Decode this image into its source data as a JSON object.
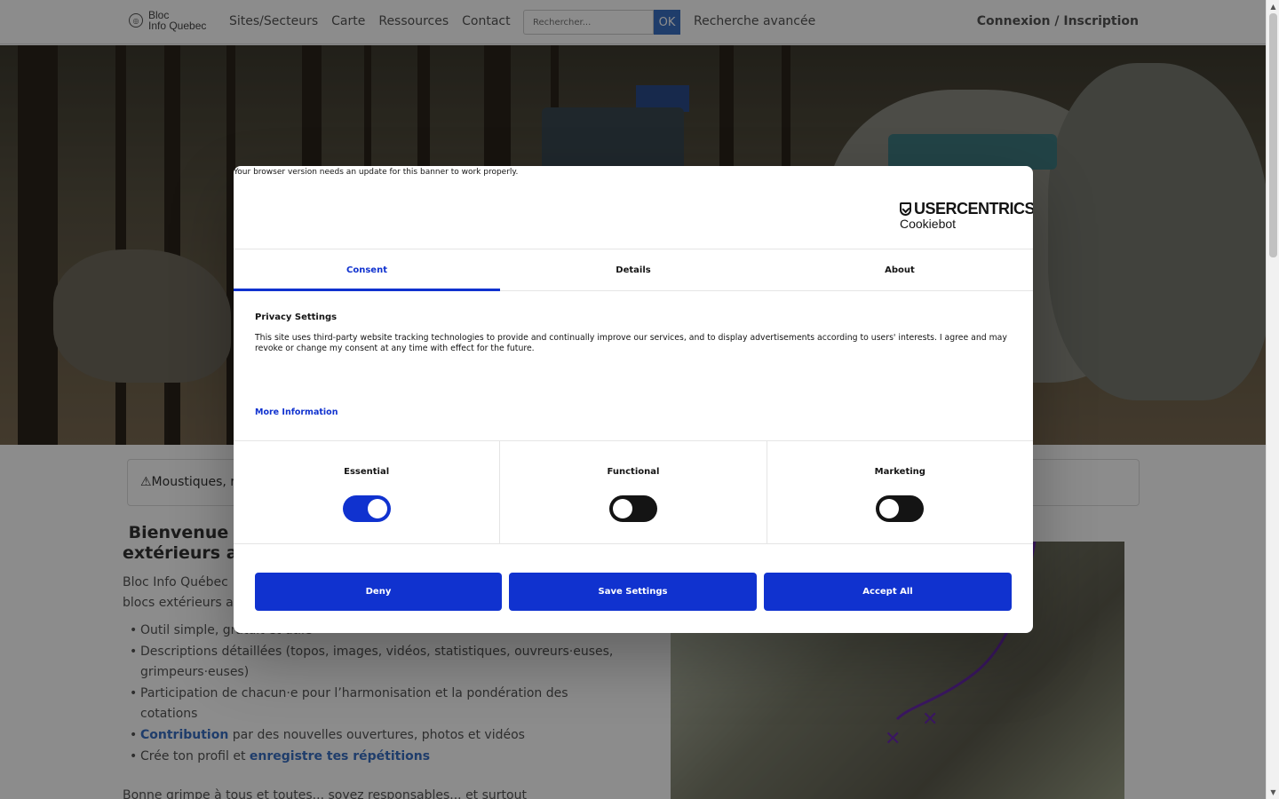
{
  "navbar": {
    "logo_line1": "Bloc",
    "logo_line2": "Info Quebec",
    "links": [
      "Sites/Secteurs",
      "Carte",
      "Ressources",
      "Contact"
    ],
    "search_placeholder": "Rechercher...",
    "search_button": "OK",
    "advanced_search": "Recherche avancée",
    "login": "Connexion / Inscription"
  },
  "page": {
    "alert_text": "⚠Moustiques, r",
    "welcome_line1": "󠀠 Bienvenue",
    "welcome_line2": "extérieurs a",
    "intro_line1": "Bloc Info Québec",
    "intro_line2": "blocs extérieurs a",
    "features": [
      {
        "text": "Outil simple, gratuit et utile"
      },
      {
        "text": "Descriptions détaillées (topos, images, vidéos, statistiques, ouvreurs·euses, grimpeurs·euses)"
      },
      {
        "text": "Participation de chacun·e pour l’harmonisation et la pondération des cotations"
      },
      {
        "link": "Contribution",
        "text": " par des nouvelles ouvertures, photos et vidéos"
      },
      {
        "text": "Crée ton profil et ",
        "link": "enregistre tes répétitions"
      }
    ],
    "closing": "Bonne grimpe à tous et toutes... soyez responsables... et surtout"
  },
  "dialog": {
    "warning": "Your browser version needs an update for this banner to work properly.",
    "brand_name": "USERCENTRICS",
    "brand_sub": "Cookiebot",
    "tabs": [
      "Consent",
      "Details",
      "About"
    ],
    "active_tab": "Consent",
    "privacy_title": "Privacy Settings",
    "privacy_body": "This site uses third-party website tracking technologies to provide and continually improve our services, and to display advertisements according to users' interests. I agree and may revoke or change my consent at any time with effect for the future.",
    "more_info": "More Information",
    "categories": [
      {
        "label": "Essential",
        "enabled": true
      },
      {
        "label": "Functional",
        "enabled": false
      },
      {
        "label": "Marketing",
        "enabled": false
      }
    ],
    "buttons": {
      "deny": "Deny",
      "save": "Save Settings",
      "accept": "Accept All"
    },
    "accent_color": "#1032cf"
  }
}
